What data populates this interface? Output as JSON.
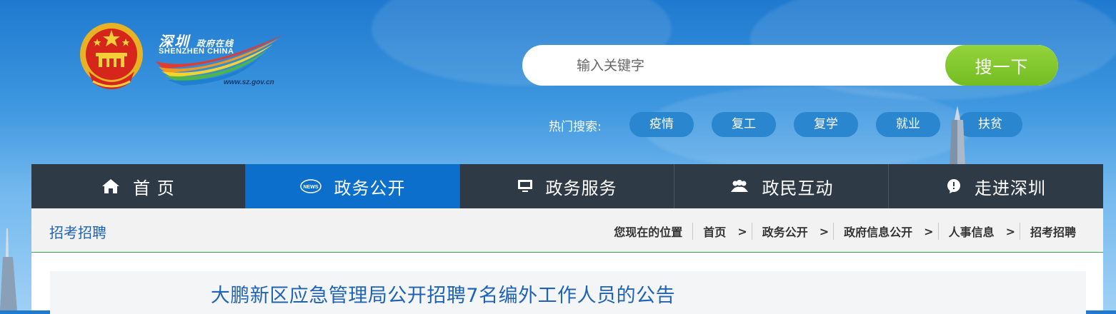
{
  "site": {
    "logo_cn": "深圳",
    "logo_cn_small": "政府在线",
    "logo_en": "SHENZHEN CHINA",
    "logo_url": "www.sz.gov.cn"
  },
  "search": {
    "placeholder": "输入关键字",
    "button_label": "搜一下"
  },
  "hot_search": {
    "label": "热门搜索:",
    "tags": [
      "疫情",
      "复工",
      "复学",
      "就业",
      "扶贫"
    ]
  },
  "nav": {
    "items": [
      {
        "label": "首 页",
        "icon": "home-icon"
      },
      {
        "label": "政务公开",
        "icon": "news-icon"
      },
      {
        "label": "政务服务",
        "icon": "monitor-icon"
      },
      {
        "label": "政民互动",
        "icon": "people-icon"
      },
      {
        "label": "走进深圳",
        "icon": "chat-bubble-icon"
      }
    ],
    "active_index": 1
  },
  "section": {
    "title": "招考招聘"
  },
  "breadcrumb": {
    "label": "您现在的位置",
    "items": [
      "首页",
      "政务公开",
      "政府信息公开",
      "人事信息",
      "招考招聘"
    ],
    "separator": ">"
  },
  "article": {
    "title": "大鹏新区应急管理局公开招聘7名编外工作人员的公告"
  },
  "colors": {
    "nav_bg": "#2e3a46",
    "nav_active": "#0c6fcb",
    "search_button": "#7cc22a",
    "hot_tag": "#2a86cf",
    "title_blue": "#1f63b6",
    "divider_green": "#3aa14b"
  }
}
